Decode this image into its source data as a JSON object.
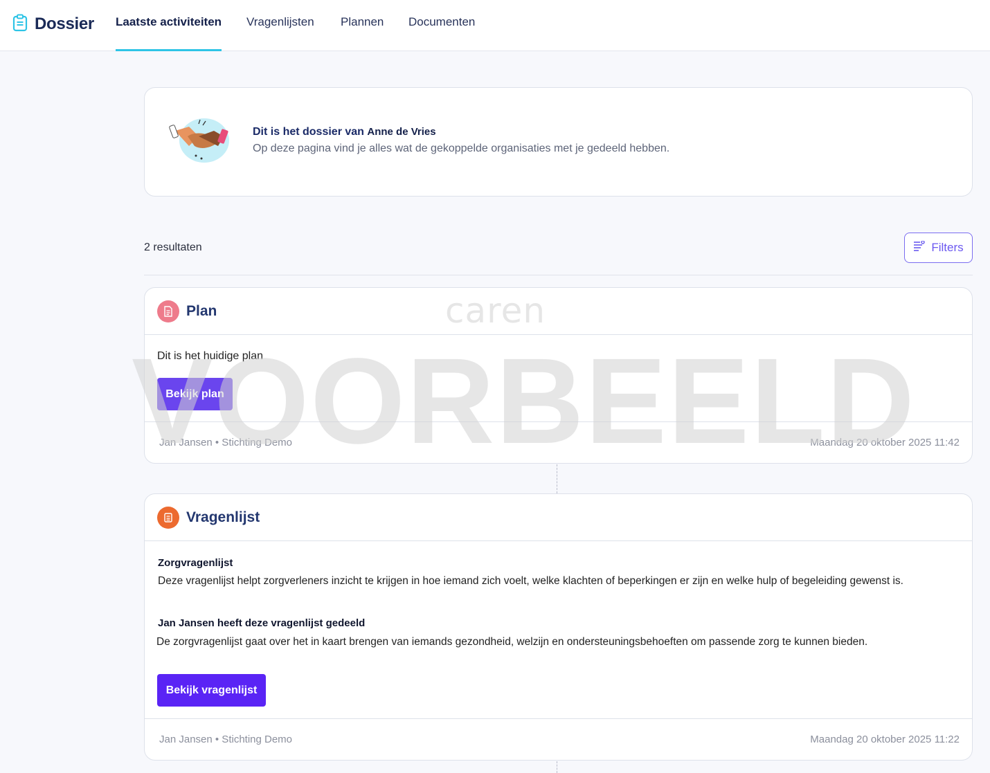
{
  "brand": {
    "title": "Dossier",
    "icon": "clipboard-icon"
  },
  "nav": {
    "tabs": [
      {
        "label": "Laatste activiteiten",
        "active": true
      },
      {
        "label": "Vragenlijsten",
        "active": false
      },
      {
        "label": "Plannen",
        "active": false
      },
      {
        "label": "Documenten",
        "active": false
      }
    ]
  },
  "intro": {
    "heading": "Dit is het dossier van",
    "name": "Anne de Vries",
    "subtitle": "Op deze pagina vind je alles wat de gekoppelde organisaties met je gedeeld hebben."
  },
  "results": {
    "count_label": "2 resultaten",
    "filters_label": "Filters"
  },
  "watermarks": {
    "logo": "caren",
    "stamp": "VOORBEELD"
  },
  "cards": [
    {
      "type_label": "Plan",
      "badge_color": "#ee7b8b",
      "description": "Dit is het huidige plan",
      "button_label": "Bekijk plan",
      "author": "Jan Jansen • Stichting Demo",
      "timestamp": "Maandag 20 oktober 2025 11:42"
    },
    {
      "type_label": "Vragenlijst",
      "badge_color": "#ec6a2f",
      "questionnaire_title": "Zorgvragenlijst",
      "questionnaire_desc": "Deze vragenlijst helpt zorgverleners inzicht te krijgen in hoe iemand zich voelt, welke klachten of beperkingen er zijn en welke hulp of begeleiding gewenst is.",
      "shared_title": "Jan Jansen heeft deze vragenlijst gedeeld",
      "shared_desc": "De zorgvragenlijst gaat over het in kaart brengen van iemands gezondheid, welzijn en ondersteuningsbehoeften om passende zorg te kunnen bieden.",
      "button_label": "Bekijk vragenlijst",
      "author": "Jan Jansen • Stichting Demo",
      "timestamp": "Maandag 20 oktober 2025 11:22"
    }
  ],
  "colors": {
    "accent": "#6a45ee",
    "tab_underline": "#2ec4e6",
    "title": "#23376f"
  }
}
